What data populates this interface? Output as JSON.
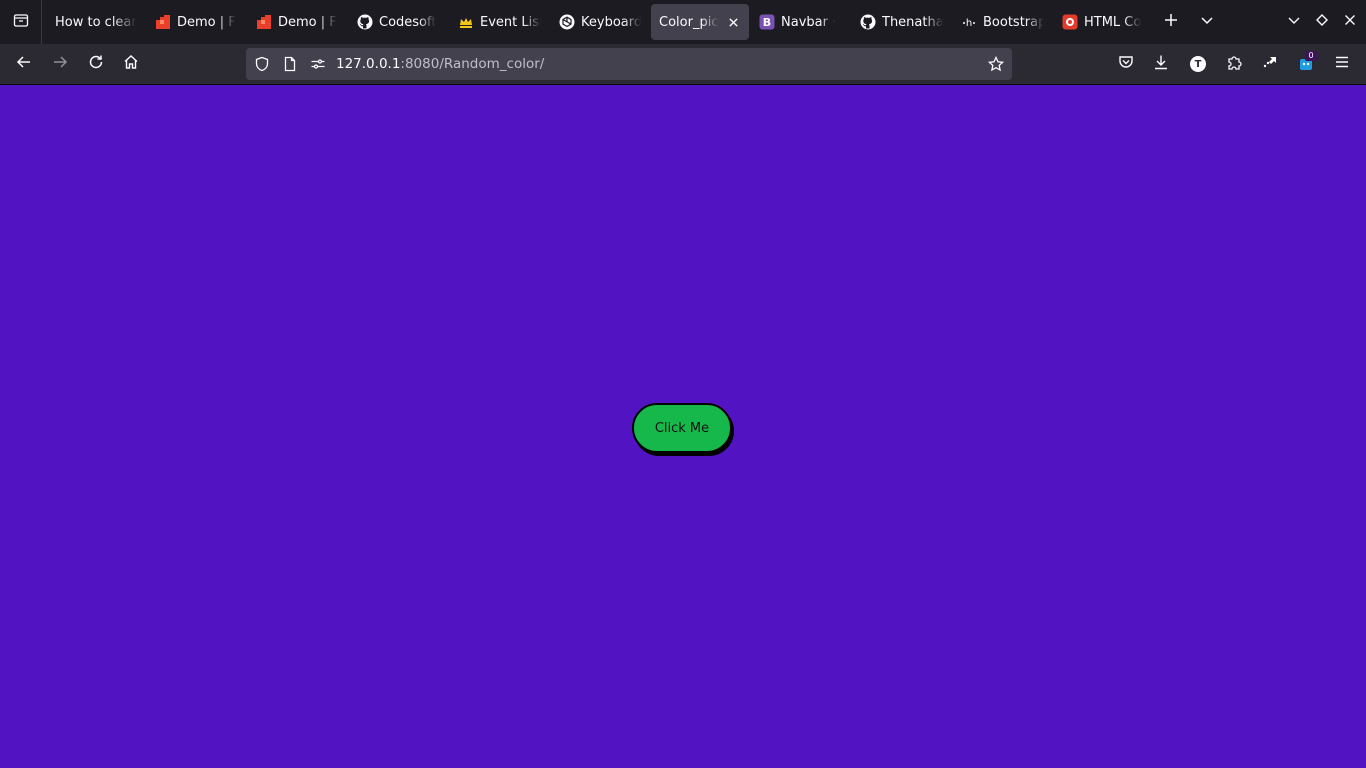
{
  "browser": {
    "tabs": [
      {
        "label": "How to clean",
        "icon": "none",
        "active": false
      },
      {
        "label": "Demo | F",
        "icon": "red-mosaic-icon",
        "active": false
      },
      {
        "label": "Demo | F",
        "icon": "red-mosaic-icon",
        "active": false
      },
      {
        "label": "Codesoft",
        "icon": "github-icon",
        "active": false
      },
      {
        "label": "Event List",
        "icon": "crown-icon",
        "active": false
      },
      {
        "label": "Keyboard",
        "icon": "openai-icon",
        "active": false
      },
      {
        "label": "Color_pick",
        "icon": "none",
        "active": true
      },
      {
        "label": "Navbar · ",
        "icon": "bootstrap-icon",
        "active": false
      },
      {
        "label": "Thenatha",
        "icon": "github-icon",
        "active": false
      },
      {
        "label": "Bootstrap",
        "icon": "hashnode-icon",
        "active": false
      },
      {
        "label": "HTML Co",
        "icon": "red-circle-icon",
        "active": false
      }
    ],
    "url": {
      "host": "127.0.0.1",
      "path": ":8080/Random_color/"
    },
    "extension_badge": "0",
    "account_initial": "T"
  },
  "page": {
    "background_color": "#5213c2",
    "button": {
      "label": "Click Me",
      "color": "#17b84b"
    }
  }
}
